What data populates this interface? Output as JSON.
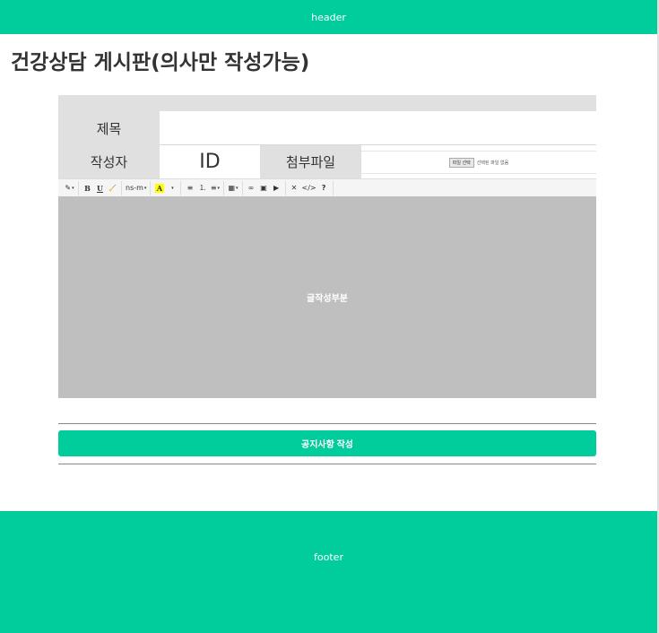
{
  "header": {
    "label": "header"
  },
  "page_title": "건강상담 게시판(의사만 작성가능)",
  "form": {
    "title_label": "제목",
    "title_value": "",
    "writer_label": "작성자",
    "writer_value": "ID",
    "attach_label": "첨부파일",
    "file_button": "파일 선택",
    "file_status": "선택된 파일 없음"
  },
  "toolbar": {
    "font_select": "ns-m",
    "color_glyph": "A",
    "buttons": {
      "style": "✎",
      "bold": "B",
      "underline": "U",
      "eraser": "🧹",
      "ul": "≡",
      "ol": "⒈",
      "align": "≡",
      "table": "▦",
      "link": "∞",
      "picture": "▣",
      "video": "▶",
      "fullscreen": "✕",
      "code": "</>",
      "help": "?"
    },
    "caret": "▾"
  },
  "editor": {
    "placeholder": "글작성부분"
  },
  "submit_label": "공지사항 작성",
  "footer": {
    "label": "footer"
  },
  "colors": {
    "accent": "#00cc9c",
    "editor_bg": "#bfbfbf",
    "label_bg": "#e0e0e0"
  }
}
